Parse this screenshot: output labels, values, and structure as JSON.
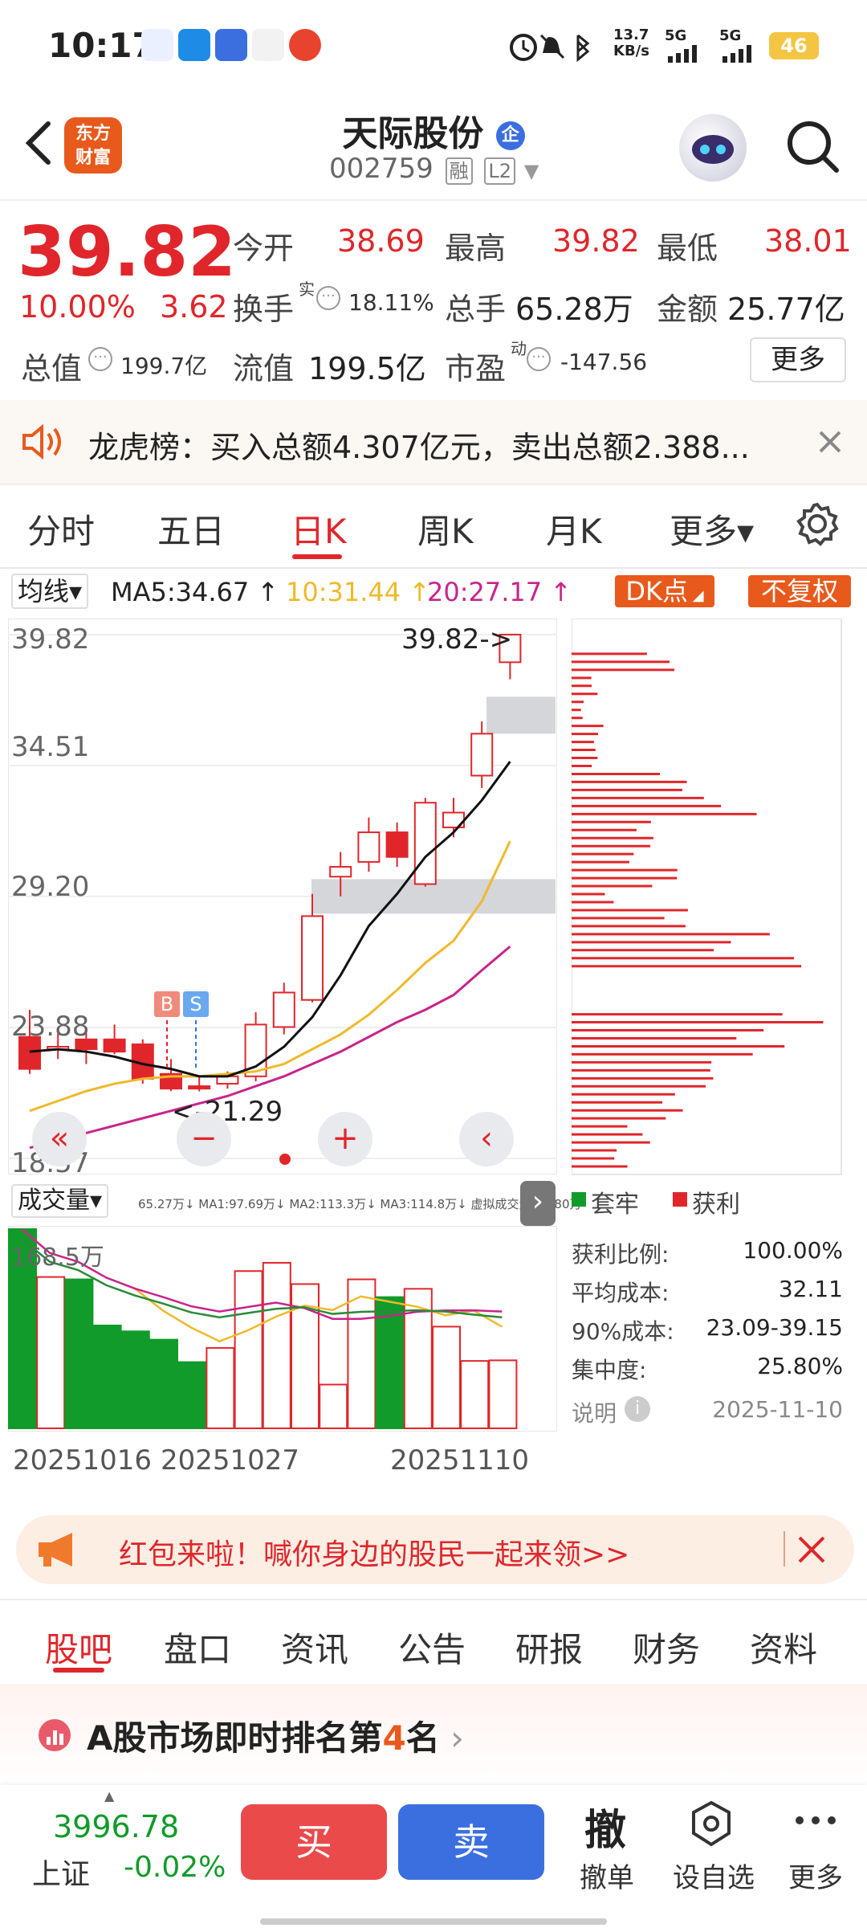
{
  "status_bar": {
    "time": "10:17",
    "net_speed": "13.7 KB/s",
    "net1": "5G",
    "net2": "5G",
    "battery": "46"
  },
  "header": {
    "stock_name": "天际股份",
    "badge": "企",
    "code": "002759",
    "tag_margin": "融",
    "tag_level": "L2",
    "logo_line1": "东方",
    "logo_line2": "财富"
  },
  "quote": {
    "price": "39.82",
    "change_pct": "10.00%",
    "change_abs": "3.62",
    "open_label": "今开",
    "open": "38.69",
    "high_label": "最高",
    "high": "39.82",
    "low_label": "最低",
    "low": "38.01",
    "turnover_label": "换手",
    "turnover_sup": "实",
    "turnover": "18.11%",
    "volume_label": "总手",
    "volume": "65.28万",
    "amount_label": "金额",
    "amount": "25.77亿",
    "mktcap_label": "总值",
    "mktcap": "199.7亿",
    "float_label": "流值",
    "float": "199.5亿",
    "pe_label": "市盈",
    "pe_sup": "动",
    "pe": "-147.56",
    "more_label": "更多"
  },
  "news": {
    "text": "龙虎榜：买入总额4.307亿元，卖出总额2.388..."
  },
  "chart_tabs": [
    {
      "label": "分时"
    },
    {
      "label": "五日"
    },
    {
      "label": "日K"
    },
    {
      "label": "周K"
    },
    {
      "label": "月K"
    },
    {
      "label": "更多▾"
    }
  ],
  "ma_bar": {
    "selector": "均线▾",
    "ma5": "MA5:34.67 ↑",
    "ma10": "10:31.44 ↑",
    "ma20": "20:27.17 ↑",
    "dk_label": "DK点",
    "fq_label": "不复权"
  },
  "price_axis": {
    "top": "39.82",
    "l2": "34.51",
    "l3": "29.20",
    "l4": "23.88",
    "bottom": "18.57"
  },
  "chart_annotations": {
    "high_marker": "39.82->",
    "low_marker": "<-21.29",
    "buy_mark": "B",
    "sell_mark": "S"
  },
  "chart_controls": {
    "rewind": "«",
    "minus": "−",
    "plus": "+",
    "prev": "‹",
    "next": "›",
    "expand": "⤢"
  },
  "volume_panel": {
    "selector": "成交量▾",
    "legend": "65.27万↓ MA1:97.69万↓ MA2:113.3万↓ MA3:114.8万↓ 虚拟成交量:70.80万",
    "axis_top": "168.5万",
    "dates": [
      "20251016",
      "20251027",
      "20251110"
    ]
  },
  "chip_panel": {
    "legend_trapped": "套牢",
    "legend_profit": "获利",
    "rows": [
      {
        "label": "获利比例:",
        "value": "100.00%"
      },
      {
        "label": "平均成本:",
        "value": "32.11"
      },
      {
        "label": "90%成本:",
        "value": "23.09-39.15"
      },
      {
        "label": "集中度:",
        "value": "25.80%"
      }
    ],
    "note_label": "说明",
    "date": "2025-11-10"
  },
  "chart_data": {
    "type": "candlestick",
    "title": "",
    "ylim": [
      18.57,
      39.82
    ],
    "yticks": [
      39.82,
      34.51,
      29.2,
      23.88,
      18.57
    ],
    "candles": [
      {
        "o": 23.5,
        "c": 22.2,
        "h": 24.6,
        "l": 22.0
      },
      {
        "o": 23.0,
        "c": 23.1,
        "h": 23.8,
        "l": 22.6
      },
      {
        "o": 23.4,
        "c": 23.0,
        "h": 23.9,
        "l": 22.4
      },
      {
        "o": 23.4,
        "c": 22.9,
        "h": 24.0,
        "l": 22.8
      },
      {
        "o": 23.2,
        "c": 21.8,
        "h": 23.4,
        "l": 21.6
      },
      {
        "o": 22.0,
        "c": 21.4,
        "h": 22.6,
        "l": 21.3
      },
      {
        "o": 21.5,
        "c": 21.4,
        "h": 21.9,
        "l": 21.29
      },
      {
        "o": 21.6,
        "c": 21.9,
        "h": 22.1,
        "l": 21.4
      },
      {
        "o": 21.9,
        "c": 24.0,
        "h": 24.5,
        "l": 21.7
      },
      {
        "o": 23.9,
        "c": 25.3,
        "h": 25.7,
        "l": 23.6
      },
      {
        "o": 25.0,
        "c": 28.4,
        "h": 29.3,
        "l": 24.9
      },
      {
        "o": 30.0,
        "c": 30.4,
        "h": 31.0,
        "l": 29.2
      },
      {
        "o": 30.6,
        "c": 31.8,
        "h": 32.4,
        "l": 30.2
      },
      {
        "o": 31.8,
        "c": 30.8,
        "h": 32.2,
        "l": 30.4
      },
      {
        "o": 29.7,
        "c": 33.0,
        "h": 33.2,
        "l": 29.6
      },
      {
        "o": 32.0,
        "c": 32.6,
        "h": 33.2,
        "l": 31.6
      },
      {
        "o": 34.1,
        "c": 35.8,
        "h": 36.3,
        "l": 33.6
      },
      {
        "o": 38.7,
        "c": 39.82,
        "h": 39.82,
        "l": 38.01
      }
    ],
    "ma5": [
      22.9,
      23.0,
      22.9,
      22.7,
      22.4,
      22.2,
      21.9,
      21.9,
      22.3,
      23.1,
      24.3,
      26.0,
      28.0,
      29.3,
      30.8,
      31.8,
      33.1,
      34.67
    ],
    "ma10": [
      20.5,
      20.9,
      21.3,
      21.6,
      21.8,
      21.9,
      21.9,
      22.0,
      22.1,
      22.4,
      23.0,
      23.6,
      24.4,
      25.4,
      26.5,
      27.4,
      29.0,
      31.44
    ],
    "ma20": [
      19.0,
      19.3,
      19.6,
      19.9,
      20.2,
      20.5,
      20.8,
      21.1,
      21.5,
      21.9,
      22.4,
      22.9,
      23.5,
      24.1,
      24.6,
      25.2,
      26.2,
      27.17
    ],
    "volume_wan": [
      168.5,
      128.0,
      126.0,
      87.0,
      82.0,
      75.0,
      56.0,
      68.0,
      133.0,
      140.0,
      122.0,
      37.0,
      126.0,
      111.0,
      118.0,
      86.0,
      57.0,
      57.5
    ],
    "chip_profit": [
      0.58,
      0.4,
      0.1,
      0.05,
      0.12,
      0.1,
      0.45,
      0.7,
      0.35,
      0.3,
      0.42,
      0.16,
      0.5,
      0.75,
      0.9,
      1.0,
      0.95,
      0.88,
      0.7,
      0.55,
      0.42,
      0.3,
      0.22
    ],
    "chip_trapped": []
  },
  "promo": {
    "text": "红包来啦！喊你身边的股民一起来领>>"
  },
  "bottom_tabs": [
    {
      "label": "股吧"
    },
    {
      "label": "盘口"
    },
    {
      "label": "资讯"
    },
    {
      "label": "公告"
    },
    {
      "label": "研报"
    },
    {
      "label": "财务"
    },
    {
      "label": "资料"
    }
  ],
  "rank": {
    "prefix": "A股市场即时排名第",
    "number": "4",
    "suffix": "名"
  },
  "bottom_nav": {
    "index_value": "3996.78",
    "index_name": "上证",
    "index_change": "-0.02%",
    "buy": "买",
    "sell": "卖",
    "cancel_icon": "撤",
    "cancel_label": "撤单",
    "watch_label": "设自选",
    "more_label": "更多"
  },
  "colors": {
    "red": "#e0262b",
    "green": "#109b2a",
    "yellow": "#f0b92a",
    "magenta": "#c8248c",
    "orange": "#e85a1c"
  }
}
